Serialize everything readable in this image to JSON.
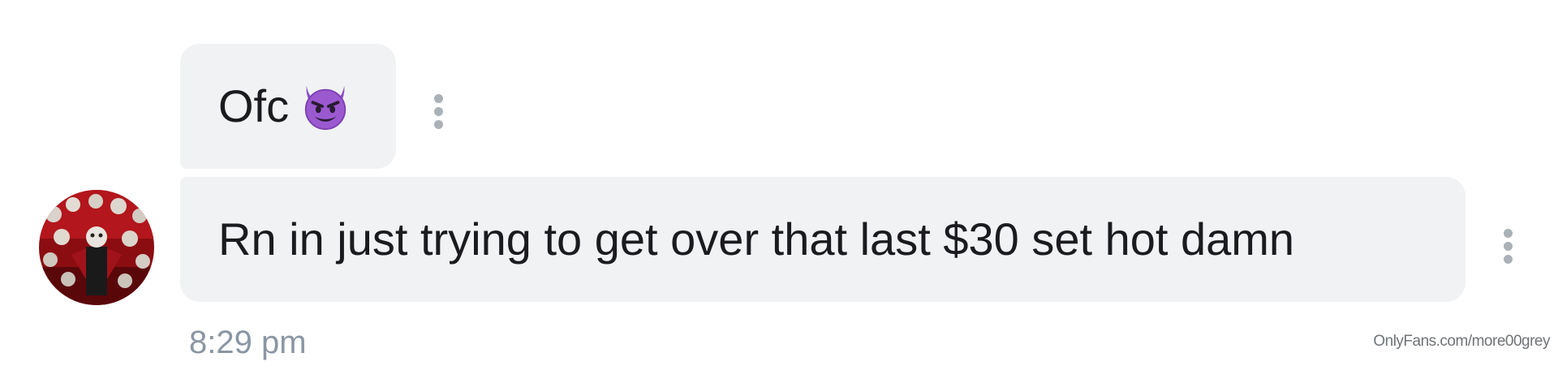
{
  "messages": [
    {
      "text": "Ofc",
      "emoji": "smiling-imp-emoji"
    },
    {
      "text": "Rn in just trying to get over that last $30 set hot damn"
    }
  ],
  "timestamp": "8:29 pm",
  "watermark": "OnlyFans.com/more00grey",
  "colors": {
    "bubble_bg": "#f0f2f3",
    "text": "#1b1b1f",
    "timestamp": "#8a96a3",
    "menu_dots": "#aab2b8",
    "emoji_purple": "#8e4fc6"
  },
  "icons": {
    "message_menu": "more-vertical-icon",
    "avatar": "user-avatar"
  }
}
